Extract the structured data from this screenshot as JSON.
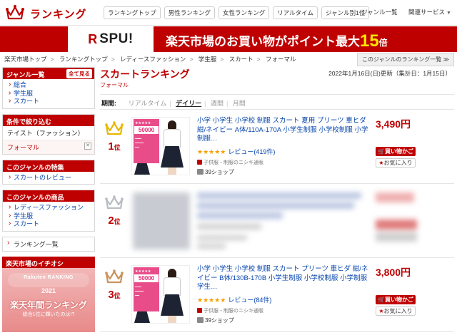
{
  "header": {
    "site_title": "ランキング",
    "nav_pills": [
      "ランキングトップ",
      "男性ランキング",
      "女性ランキング",
      "リアルタイム",
      "ジャンル別1位"
    ],
    "genre_list": "ジャンル一覧",
    "related": "関連サービス"
  },
  "banner": {
    "spu_label": "SPU!",
    "text_main": "楽天市場のお買い物がポイント最大",
    "text_num": "15",
    "text_unit": "倍"
  },
  "breadcrumb": [
    "楽天市場トップ",
    "ランキングトップ",
    "レディースファッション",
    "学生服",
    "スカート",
    "フォーマル"
  ],
  "genre_ranking_button": "このジャンルのランキング一覧 ≫",
  "sidebar": {
    "genre_title": "ジャンル一覧",
    "genre_all": "全て見る",
    "genre_items": [
      "総合",
      "学生服",
      "スカート"
    ],
    "filter_title": "条件で絞り込む",
    "filter_row": "テイスト（ファッション）",
    "filter_selected": "フォーマル",
    "features_title": "このジャンルの特集",
    "features_items": [
      "スカートのレビュー"
    ],
    "products_title": "このジャンルの商品",
    "products_items": [
      "レディースファッション",
      "学生服",
      "スカート"
    ],
    "ranking_list": "ランキング一覧",
    "ichioshi_title": "楽天市場のイチオシ",
    "promo": {
      "rk": "Rakuten RANKING",
      "yr": "2021",
      "title": "楽天年間ランキング",
      "sub": "総合1位に輝いたのは!?"
    }
  },
  "main": {
    "title": "スカートランキング",
    "subtitle": "フォーマル",
    "date": "2022年1月16日(日)更新（集計日：1月15日）",
    "period_label": "期間:",
    "periods": [
      "リアルタイム",
      "デイリー",
      "週間",
      "月間"
    ],
    "active_period": "デイリー"
  },
  "items": [
    {
      "rank": "1",
      "rank_unit": "位",
      "crown": "gold-crown-icon",
      "title": "小学 小学生 小学校 制服 スカート 夏用 プリーツ 車ヒダ 紺/ネイビー A体/110A-170A 小学生制服 小学校制服 小学制服…",
      "stars": "★★★★★",
      "reviews": "レビュー(419件)",
      "shop_sub": "子供服・制服のニシキ通販",
      "shops": "39ショップ",
      "price": "3,490円",
      "promo_price": "50000",
      "cart": "買い物かご",
      "fav": "お気に入り"
    },
    {
      "rank": "2",
      "rank_unit": "位",
      "crown": "silver-crown-icon"
    },
    {
      "rank": "3",
      "rank_unit": "位",
      "crown": "bronze-crown-icon",
      "title": "小学 小学生 小学校 制服 スカート プリーツ 車ヒダ 紺/ネイビー B体/130B-170B 小学生制服 小学校制服 小学制服 学生…",
      "stars": "★★★★★",
      "reviews": "レビュー(84件)",
      "shop_sub": "子供服・制服のニシキ通販",
      "shops": "39ショップ",
      "price": "3,800円",
      "promo_price": "50000",
      "cart": "買い物かご",
      "fav": "お気に入り"
    }
  ],
  "colors": {
    "accent": "#bf0000",
    "gold": "#e8b800",
    "silver": "#b9bcc2",
    "bronze": "#c9925a",
    "link": "#0645ad"
  }
}
